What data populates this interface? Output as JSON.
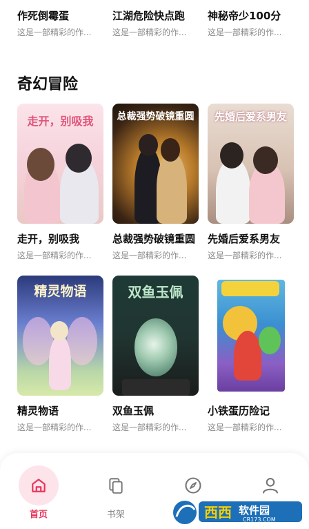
{
  "top_row": [
    {
      "title": "作死倒霉蛋",
      "desc": "这是一部精彩的作..."
    },
    {
      "title": "江湖危险快点跑",
      "desc": "这是一部精彩的作..."
    },
    {
      "title": "神秘帝少100分",
      "desc": "这是一部精彩的作..."
    }
  ],
  "section": {
    "title": "奇幻冒险"
  },
  "row1": [
    {
      "title": "走开，别吸我",
      "desc": "这是一部精彩的作...",
      "cover_text": "走开，别吸我"
    },
    {
      "title": "总裁强势破镜重圆",
      "desc": "这是一部精彩的作...",
      "cover_text": "总裁强势破镜重圆"
    },
    {
      "title": "先婚后爱系男友",
      "desc": "这是一部精彩的作...",
      "cover_text": "先婚后爱系男友"
    }
  ],
  "row2": [
    {
      "title": "精灵物语",
      "desc": "这是一部精彩的作...",
      "cover_text": "精灵物语"
    },
    {
      "title": "双鱼玉佩",
      "desc": "这是一部精彩的作...",
      "cover_text": "双鱼玉佩"
    },
    {
      "title": "小铁蛋历险记",
      "desc": "这是一部精彩的作..."
    }
  ],
  "nav": {
    "home": "首页",
    "bookshelf": "书架",
    "accent": "#e8325a",
    "inactive": "#8a8a8a"
  },
  "icons": [
    "home-icon",
    "bookshelf-icon",
    "compass-icon",
    "user-icon"
  ],
  "watermark": {
    "brand": "西西",
    "site_label": "软件园",
    "url": "CR173.COM"
  }
}
